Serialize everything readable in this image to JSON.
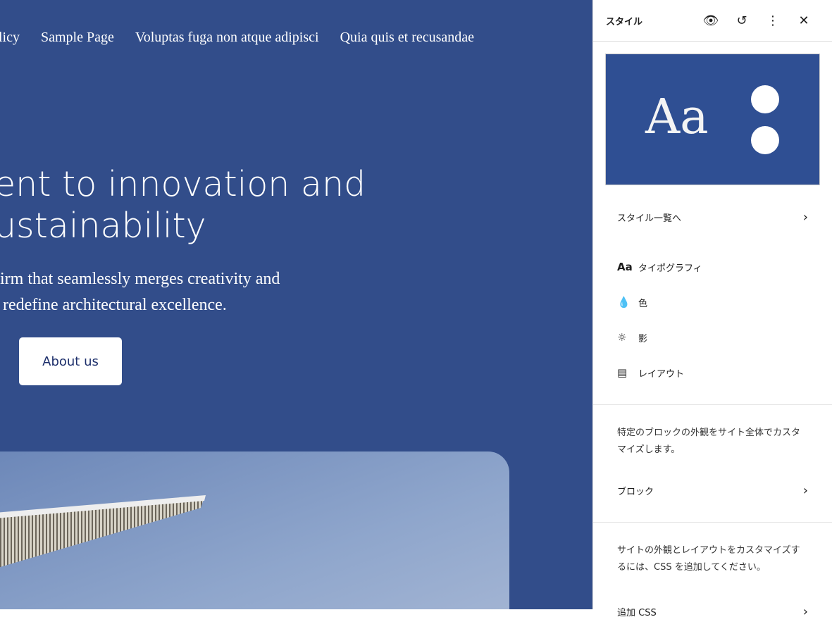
{
  "site": {
    "nav": [
      "olicy",
      "Sample Page",
      "Voluptas fuga non atque adipisci",
      "Quia quis et recusandae"
    ],
    "heading": "ent to innovation and\nustainability",
    "subtext": " firm that seamlessly merges creativity and\no redefine architectural excellence.",
    "button": "About us",
    "background_color": "#324d8a"
  },
  "panel": {
    "title": "スタイル",
    "icons": [
      "eye-icon",
      "history-icon",
      "more-vertical-icon",
      "close-icon"
    ],
    "preview_text": "Aa",
    "browse_styles": "スタイル一覧へ",
    "items": [
      {
        "icon": "Aa",
        "label": "タイポグラフィ"
      },
      {
        "icon": "droplet",
        "label": "色"
      },
      {
        "icon": "sun",
        "label": "影"
      },
      {
        "icon": "layout",
        "label": "レイアウト"
      }
    ],
    "blocks_desc": "特定のブロックの外観をサイト全体でカスタマイズします。",
    "blocks_label": "ブロック",
    "css_desc": "サイトの外観とレイアウトをカスタマイズするには、CSS を追加してください。",
    "css_label": "追加 CSS"
  }
}
